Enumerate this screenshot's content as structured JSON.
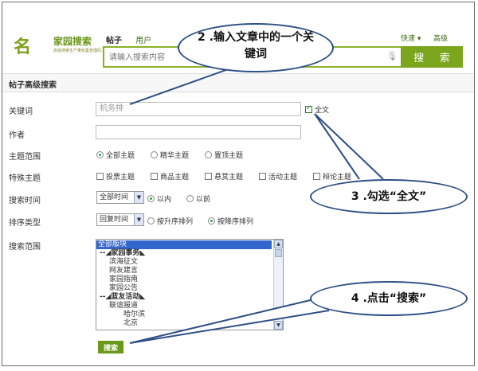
{
  "header": {
    "logo_text": "名",
    "logo_mid": "家园搜索",
    "logo_sub": "高级搜索生产量收集管理的工具",
    "tabs": [
      "帖子",
      "用户"
    ],
    "quick_link": "快速 ▾",
    "advanced_link": "高级",
    "search_placeholder": "请输入搜索内容",
    "search_button": "搜 索"
  },
  "section_title": "帖子高级搜索",
  "form": {
    "keyword_label": "关键词",
    "keyword_value": "机务排",
    "fulltext_label": "全文",
    "author_label": "作者",
    "topic_range_label": "主题范围",
    "topic_range_options": [
      "全部主题",
      "精华主题",
      "置顶主题"
    ],
    "special_label": "特殊主题",
    "special_options": [
      "投票主题",
      "商品主题",
      "悬赏主题",
      "活动主题",
      "辩论主题"
    ],
    "time_label": "搜索时间",
    "time_select": "全部时间",
    "time_options": [
      "以内",
      "以前"
    ],
    "sort_label": "排序类型",
    "sort_select": "回复时间",
    "sort_options": [
      "按升序排列",
      "按降序排列"
    ],
    "scope_label": "搜索范围",
    "scope_items": [
      {
        "text": "全部版块",
        "indent": 0,
        "selected": true
      },
      {
        "text": "--◢家园事务◣",
        "indent": 0,
        "bold": true
      },
      {
        "text": "滨海征文",
        "indent": 2
      },
      {
        "text": "网友建言",
        "indent": 2
      },
      {
        "text": "家园指南",
        "indent": 2
      },
      {
        "text": "家园公告",
        "indent": 2
      },
      {
        "text": "--◢蓝友活动◣",
        "indent": 0,
        "bold": true
      },
      {
        "text": "联谊报道",
        "indent": 2
      },
      {
        "text": "哈尔滨",
        "indent": 5
      },
      {
        "text": "北京",
        "indent": 5
      }
    ],
    "submit_label": "搜索"
  },
  "callouts": {
    "step2": "2 .输入文章中的一个关键词",
    "step3": "3 .勾选“全文”",
    "step4": "4 .点击“搜索”"
  }
}
